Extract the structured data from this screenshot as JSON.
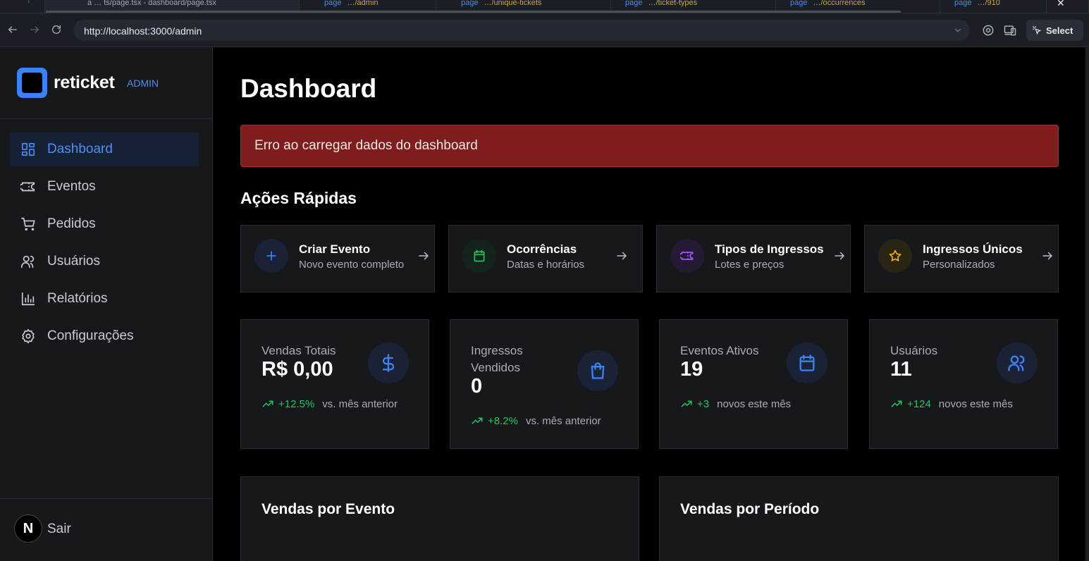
{
  "browser": {
    "tabs": [
      {
        "file": "",
        "path": "",
        "text": "a  …  ts/page.tsx - dashboard/page.tsx"
      },
      {
        "file": "page",
        "path": "…/admin",
        "text": ""
      },
      {
        "file": "page",
        "path": "…/unique-tickets",
        "text": ""
      },
      {
        "file": "page",
        "path": "…/ticket-types",
        "text": ""
      },
      {
        "file": "page",
        "path": "…/occurrences",
        "text": ""
      },
      {
        "file": "page",
        "path": "…/910",
        "text": ""
      }
    ],
    "url": "http://localhost:3000/admin",
    "select_label": "Select"
  },
  "sidebar": {
    "brand": "reticket",
    "tag": "ADMIN",
    "items": [
      {
        "label": "Dashboard",
        "icon": "dashboard-icon",
        "active": true
      },
      {
        "label": "Eventos",
        "icon": "ticket-icon",
        "active": false
      },
      {
        "label": "Pedidos",
        "icon": "cart-icon",
        "active": false
      },
      {
        "label": "Usuários",
        "icon": "users-icon",
        "active": false
      },
      {
        "label": "Relatórios",
        "icon": "bar-chart-icon",
        "active": false
      },
      {
        "label": "Configurações",
        "icon": "gear-icon",
        "active": false
      }
    ],
    "avatar_letter": "N",
    "logout": "Sair"
  },
  "main": {
    "title": "Dashboard",
    "error": "Erro ao carregar dados do dashboard",
    "quick_actions_title": "Ações Rápidas",
    "quick_actions": [
      {
        "title": "Criar Evento",
        "subtitle": "Novo evento completo",
        "icon": "plus-icon",
        "color": "#3b82f6"
      },
      {
        "title": "Ocorrências",
        "subtitle": "Datas e horários",
        "icon": "calendar-icon",
        "color": "#22c55e"
      },
      {
        "title": "Tipos de Ingressos",
        "subtitle": "Lotes e preços",
        "icon": "ticket-icon",
        "color": "#a855f7"
      },
      {
        "title": "Ingressos Únicos",
        "subtitle": "Personalizados",
        "icon": "star-icon",
        "color": "#eab308"
      }
    ],
    "stats": [
      {
        "label": "Vendas Totais",
        "value": "R$ 0,00",
        "trend": "+12.5%",
        "trend_text": "vs. mês anterior",
        "icon": "dollar-icon"
      },
      {
        "label": "Ingressos Vendidos",
        "value": "0",
        "trend": "+8.2%",
        "trend_text": "vs. mês anterior",
        "icon": "shopping-bag-icon"
      },
      {
        "label": "Eventos Ativos",
        "value": "19",
        "trend": "+3",
        "trend_text": "novos este mês",
        "icon": "calendar-icon"
      },
      {
        "label": "Usuários",
        "value": "11",
        "trend": "+124",
        "trend_text": "novos este mês",
        "icon": "users-icon"
      }
    ],
    "panels": [
      {
        "title": "Vendas por Evento"
      },
      {
        "title": "Vendas por Período"
      }
    ]
  },
  "colors": {
    "accent": "#3b82f6",
    "error_bg": "#7f1d1d",
    "positive": "#22c55e"
  }
}
